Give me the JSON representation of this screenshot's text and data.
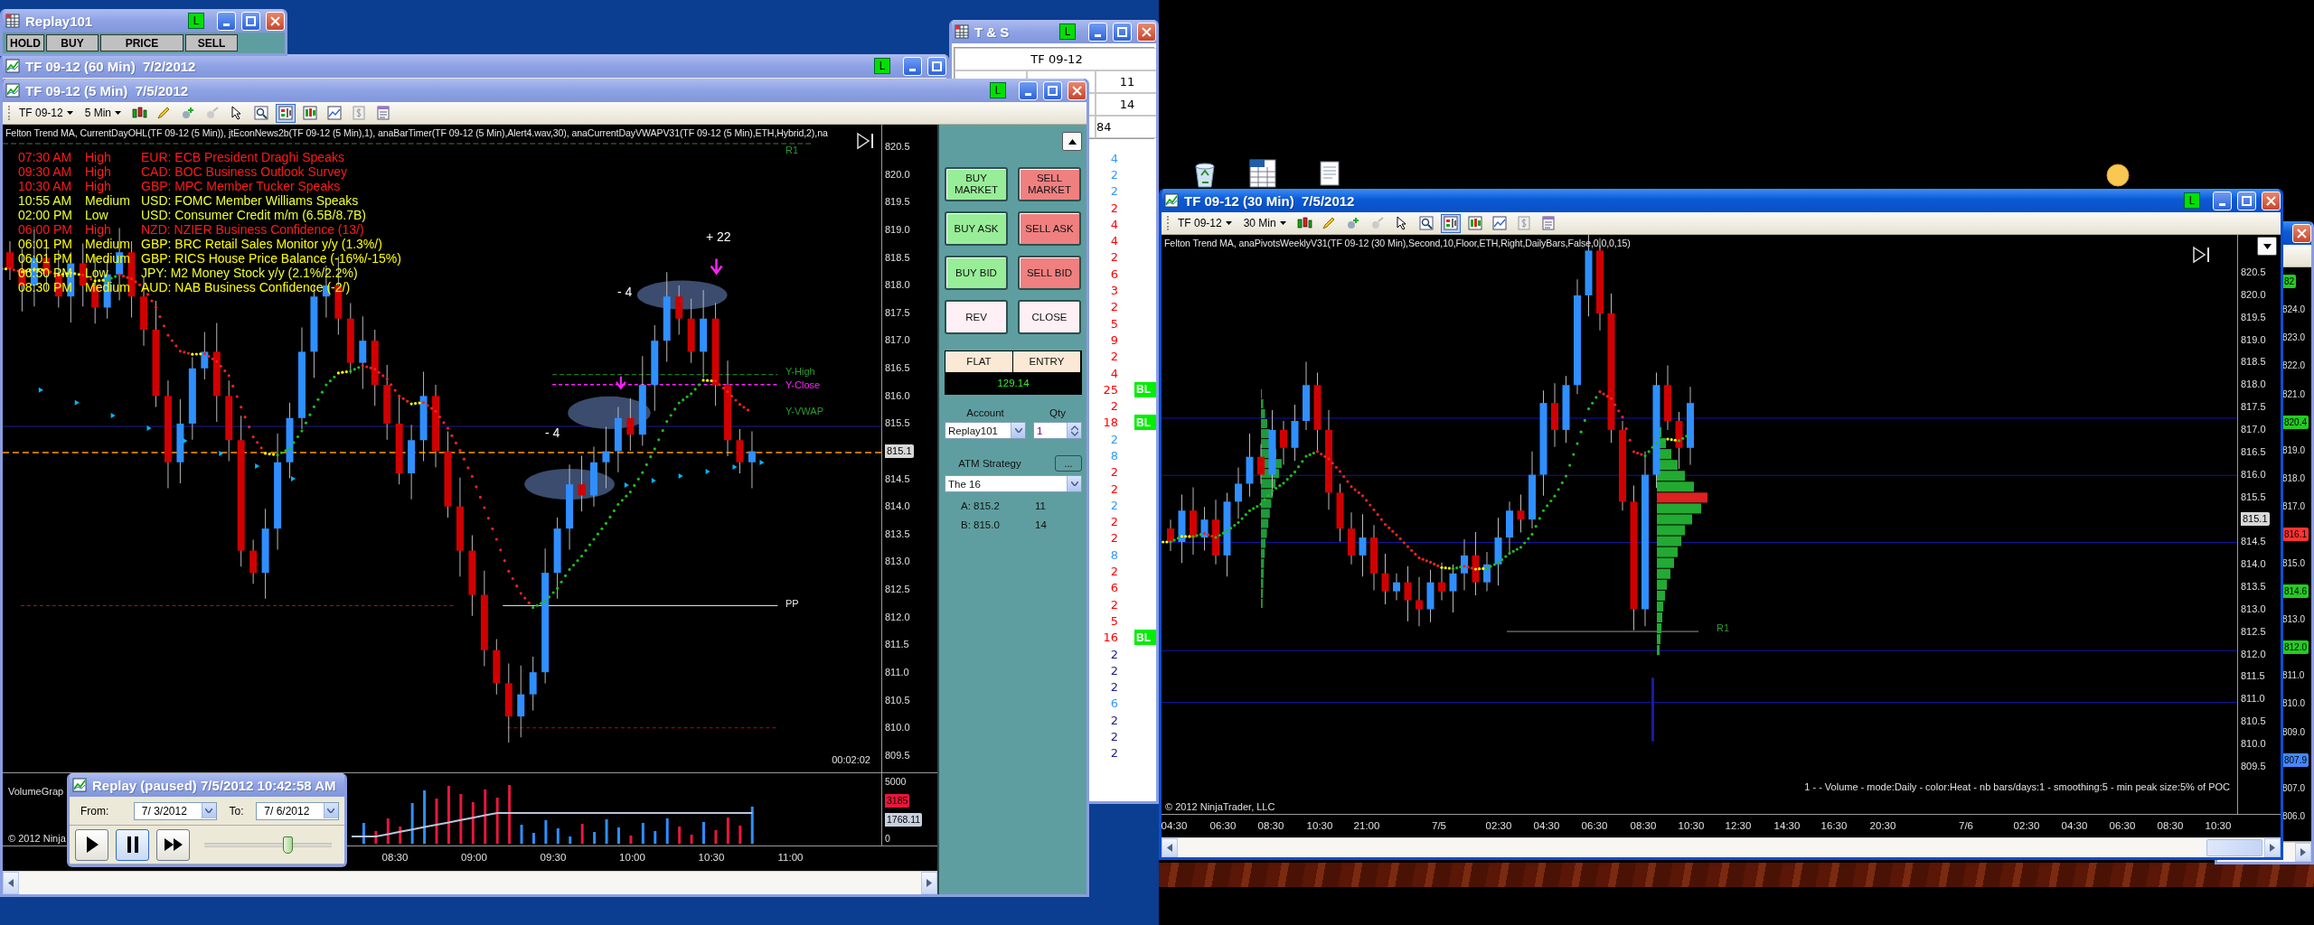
{
  "replay_account_window": {
    "title": "Replay101",
    "live_badge": "L",
    "columns": [
      "HOLD",
      "BUY",
      "PRICE",
      "SELL"
    ]
  },
  "chart_60min_window": {
    "title": "TF 09-12 (60 Min)  7/2/2012",
    "live_badge": "L"
  },
  "time_and_sales": {
    "title": "T & S",
    "live_badge": "L",
    "instrument": "TF 09-12",
    "quote_sizes": [
      "11",
      "14"
    ],
    "quote_note": "84",
    "trades": [
      {
        "size": "4",
        "color": "#3399ff"
      },
      {
        "size": "2",
        "color": "#3399ff"
      },
      {
        "size": "2",
        "color": "#3399ff"
      },
      {
        "size": "2",
        "color": "#ff0000"
      },
      {
        "size": "4",
        "color": "#ff0000"
      },
      {
        "size": "4",
        "color": "#ff0000"
      },
      {
        "size": "2",
        "color": "#ff0000"
      },
      {
        "size": "6",
        "color": "#ff0000"
      },
      {
        "size": "3",
        "color": "#ff0000"
      },
      {
        "size": "2",
        "color": "#ff0000"
      },
      {
        "size": "5",
        "color": "#ff0000"
      },
      {
        "size": "9",
        "color": "#ff0000"
      },
      {
        "size": "2",
        "color": "#ff0000"
      },
      {
        "size": "4",
        "color": "#ff0000"
      },
      {
        "size": "25",
        "color": "#ff0000",
        "badge": "BL"
      },
      {
        "size": "2",
        "color": "#ff0000"
      },
      {
        "size": "18",
        "color": "#ff0000",
        "badge": "BL"
      },
      {
        "size": "2",
        "color": "#3399ff"
      },
      {
        "size": "8",
        "color": "#3399ff"
      },
      {
        "size": "2",
        "color": "#ff0000"
      },
      {
        "size": "2",
        "color": "#ff0000"
      },
      {
        "size": "2",
        "color": "#3399ff"
      },
      {
        "size": "2",
        "color": "#ff0000"
      },
      {
        "size": "2",
        "color": "#ff0000"
      },
      {
        "size": "8",
        "color": "#3399ff"
      },
      {
        "size": "2",
        "color": "#ff0000"
      },
      {
        "size": "6",
        "color": "#ff0000"
      },
      {
        "size": "2",
        "color": "#ff0000"
      },
      {
        "size": "5",
        "color": "#ff0000"
      },
      {
        "size": "16",
        "color": "#ff0000",
        "badge": "BL"
      },
      {
        "size": "2",
        "color": "#1c1c8c"
      },
      {
        "size": "2",
        "color": "#1c1c8c"
      },
      {
        "size": "2",
        "color": "#1c1c8c"
      },
      {
        "size": "6",
        "color": "#3399ff"
      },
      {
        "size": "2",
        "color": "#1c1c8c"
      },
      {
        "size": "2",
        "color": "#1c1c8c"
      },
      {
        "size": "2",
        "color": "#1c1c8c"
      }
    ]
  },
  "main_chart": {
    "title": "TF 09-12 (5 Min)  7/5/2012",
    "live_badge": "L",
    "toolbar": {
      "instrument": "TF 09-12",
      "interval": "5 Min",
      "chart_trader_on": true
    },
    "indicators": "Felton Trend MA, CurrentDayOHL(TF 09-12 (5 Min)), jtEconNews2b(TF 09-12 (5 Min),1), anaBarTimer(TF 09-12 (5 Min),Alert4.wav,30), anaCurrentDayVWAPV31(TF 09-12 (5 Min),ETH,Hybrid,2),na",
    "news": [
      {
        "time": "07:30 AM",
        "impact": "High",
        "event": "EUR: ECB President Draghi Speaks",
        "color": "#ff1a1a"
      },
      {
        "time": "09:30 AM",
        "impact": "High",
        "event": "CAD: BOC Business Outlook Survey",
        "color": "#ff1a1a"
      },
      {
        "time": "10:30 AM",
        "impact": "High",
        "event": "GBP: MPC Member Tucker Speaks",
        "color": "#ff1a1a"
      },
      {
        "time": "10:55 AM",
        "impact": "Medium",
        "event": "USD: FOMC Member Williams Speaks",
        "color": "#eeff33"
      },
      {
        "time": "02:00 PM",
        "impact": "Low",
        "event": "USD: Consumer Credit m/m (6.5B/8.7B)",
        "color": "#eeff33"
      },
      {
        "time": "06:00 PM",
        "impact": "High",
        "event": "NZD: NZIER Business Confidence (13/)",
        "color": "#ff1a1a"
      },
      {
        "time": "06:01 PM",
        "impact": "Medium",
        "event": "GBP: BRC Retail Sales Monitor y/y (1.3%/)",
        "color": "#ffff00"
      },
      {
        "time": "06:01 PM",
        "impact": "Medium",
        "event": "GBP: RICS House Price Balance (-16%/-15%)",
        "color": "#ffff00"
      },
      {
        "time": "06:50 PM",
        "impact": "Low",
        "event": "JPY: M2 Money Stock y/y (2.1%/2.2%)",
        "color": "#eeff33"
      },
      {
        "time": "08:30 PM",
        "impact": "Medium",
        "event": "AUD: NAB Business Confidence (-2/)",
        "color": "#ffff00"
      }
    ],
    "labels": [
      "R1",
      "Y-High",
      "Y-Close",
      "Y-VWAP",
      "PP",
      "+ 22",
      "- 4",
      "- 4"
    ],
    "bar_timer": "00:02:02",
    "price_axis": [
      {
        "text": "820.5",
        "kind": "tick"
      },
      {
        "text": "820.0",
        "kind": "tick"
      },
      {
        "text": "819.5",
        "kind": "tick"
      },
      {
        "text": "819.0",
        "kind": "tick"
      },
      {
        "text": "818.5",
        "kind": "tick"
      },
      {
        "text": "818.0",
        "kind": "tick"
      },
      {
        "text": "817.5",
        "kind": "tick"
      },
      {
        "text": "817.0",
        "kind": "tick"
      },
      {
        "text": "816.5",
        "kind": "tick"
      },
      {
        "text": "816.0",
        "kind": "tick"
      },
      {
        "text": "815.5",
        "kind": "tick"
      },
      {
        "text": "815.1",
        "kind": "tag",
        "color": "#d8d8d8"
      },
      {
        "text": "814.5",
        "kind": "tick"
      },
      {
        "text": "814.0",
        "kind": "tick"
      },
      {
        "text": "813.5",
        "kind": "tick"
      },
      {
        "text": "813.0",
        "kind": "tick"
      },
      {
        "text": "812.5",
        "kind": "tick"
      },
      {
        "text": "812.0",
        "kind": "tick"
      },
      {
        "text": "811.5",
        "kind": "tick"
      },
      {
        "text": "811.0",
        "kind": "tick"
      },
      {
        "text": "810.5",
        "kind": "tick"
      },
      {
        "text": "810.0",
        "kind": "tick"
      },
      {
        "text": "809.5",
        "kind": "tick"
      }
    ],
    "volume": {
      "title": "VolumeGrap",
      "axis": [
        {
          "text": "5000",
          "kind": "tick"
        },
        {
          "text": "3185",
          "kind": "tag",
          "color": "#e8173c"
        },
        {
          "text": "1768.11",
          "kind": "tag",
          "color": "#c8d0e0"
        },
        {
          "text": "0",
          "kind": "tick"
        }
      ]
    },
    "time_axis": [
      "08:30",
      "09:00",
      "09:30",
      "10:00",
      "10:30",
      "11:00"
    ],
    "copyright": "© 2012 Ninja",
    "chart_trader": {
      "buttons": [
        {
          "label": "BUY MARKET",
          "kind": "buy"
        },
        {
          "label": "SELL MARKET",
          "kind": "sell"
        },
        {
          "label": "BUY ASK",
          "kind": "buy"
        },
        {
          "label": "SELL ASK",
          "kind": "sell"
        },
        {
          "label": "BUY BID",
          "kind": "buy"
        },
        {
          "label": "SELL BID",
          "kind": "sell"
        },
        {
          "label": "REV",
          "kind": "neutral"
        },
        {
          "label": "CLOSE",
          "kind": "neutral"
        }
      ],
      "position": {
        "status": "FLAT",
        "entry_label": "ENTRY",
        "pnl": "129.14"
      },
      "account_label": "Account",
      "qty_label": "Qty",
      "account": "Replay101",
      "qty": "1",
      "atm_label": "ATM Strategy",
      "atm_button": "...",
      "atm_strategy": "The 16",
      "quotes": [
        {
          "label": "A: 815.2",
          "size": "11"
        },
        {
          "label": "B: 815.0",
          "size": "14"
        }
      ]
    }
  },
  "replay_dialog": {
    "title": "Replay (paused) 7/5/2012 10:42:58 AM",
    "from_label": "From:",
    "from": "7/ 3/2012",
    "to_label": "To:",
    "to": "7/ 6/2012",
    "controls": [
      {
        "kind": "play",
        "selected": false
      },
      {
        "kind": "pause",
        "selected": true
      },
      {
        "kind": "fast_forward",
        "selected": false
      }
    ],
    "speed": {
      "level": 0.65
    }
  },
  "right_chart": {
    "title": "TF 09-12 (30 Min)  7/5/2012",
    "live_badge": "L",
    "toolbar": {
      "instrument": "TF 09-12",
      "interval": "30 Min",
      "chart_trader_on": true
    },
    "indicators": "Felton Trend MA, anaPivotsWeeklyV31(TF 09-12 (30 Min),Second,10,Floor,ETH,Right,DailyBars,False,0,0,0,15)",
    "price_axis": [
      {
        "text": "820.5",
        "kind": "tick"
      },
      {
        "text": "820.0",
        "kind": "tick"
      },
      {
        "text": "819.5",
        "kind": "tick"
      },
      {
        "text": "819.0",
        "kind": "tick"
      },
      {
        "text": "818.5",
        "kind": "tick"
      },
      {
        "text": "818.0",
        "kind": "tick"
      },
      {
        "text": "817.5",
        "kind": "tick"
      },
      {
        "text": "817.0",
        "kind": "tick"
      },
      {
        "text": "816.5",
        "kind": "tick"
      },
      {
        "text": "816.0",
        "kind": "tick"
      },
      {
        "text": "815.5",
        "kind": "tick"
      },
      {
        "text": "815.1",
        "kind": "tag",
        "color": "#d8d8d8"
      },
      {
        "text": "814.5",
        "kind": "tick"
      },
      {
        "text": "814.0",
        "kind": "tick"
      },
      {
        "text": "813.5",
        "kind": "tick"
      },
      {
        "text": "813.0",
        "kind": "tick"
      },
      {
        "text": "812.5",
        "kind": "tick"
      },
      {
        "text": "812.0",
        "kind": "tick"
      },
      {
        "text": "811.5",
        "kind": "tick"
      },
      {
        "text": "811.0",
        "kind": "tick"
      },
      {
        "text": "810.5",
        "kind": "tick"
      },
      {
        "text": "810.0",
        "kind": "tick"
      },
      {
        "text": "809.5",
        "kind": "tick"
      }
    ],
    "pivot_label": "R1",
    "profile_info": "1 -   - Volume - mode:Daily  - color:Heat - nb bars/days:1 - smoothing:5 - min peak size:5% of POC",
    "copyright": "© 2012 NinjaTrader, LLC",
    "time_axis": [
      "04:30",
      "06:30",
      "08:30",
      "10:30",
      "21:00",
      "7/5",
      "02:30",
      "04:30",
      "06:30",
      "08:30",
      "10:30",
      "12:30",
      "14:30",
      "16:30",
      "20:30",
      "7/6",
      "02:30",
      "04:30",
      "06:30",
      "08:30",
      "10:30"
    ]
  },
  "back_chart": {
    "price_axis": [
      {
        "text": "82",
        "kind": "tag",
        "color": "#22cc22"
      },
      {
        "text": "824.0",
        "kind": "tick"
      },
      {
        "text": "823.0",
        "kind": "tick"
      },
      {
        "text": "822.0",
        "kind": "tick"
      },
      {
        "text": "821.0",
        "kind": "tick"
      },
      {
        "text": "820.4",
        "kind": "tag",
        "color": "#22cc22"
      },
      {
        "text": "819.0",
        "kind": "tick"
      },
      {
        "text": "818.0",
        "kind": "tick"
      },
      {
        "text": "817.0",
        "kind": "tick"
      },
      {
        "text": "816.1",
        "kind": "tag",
        "color": "#ff3333"
      },
      {
        "text": "815.0",
        "kind": "tick"
      },
      {
        "text": "814.6",
        "kind": "tag",
        "color": "#22cc22"
      },
      {
        "text": "813.0",
        "kind": "tick"
      },
      {
        "text": "812.0",
        "kind": "tag",
        "color": "#22cc22"
      },
      {
        "text": "811.0",
        "kind": "tick"
      },
      {
        "text": "810.0",
        "kind": "tick"
      },
      {
        "text": "809.0",
        "kind": "tick"
      },
      {
        "text": "807.9",
        "kind": "tag",
        "color": "#4488ff"
      },
      {
        "text": "807.0",
        "kind": "tick"
      },
      {
        "text": "806.0",
        "kind": "tick"
      }
    ]
  }
}
